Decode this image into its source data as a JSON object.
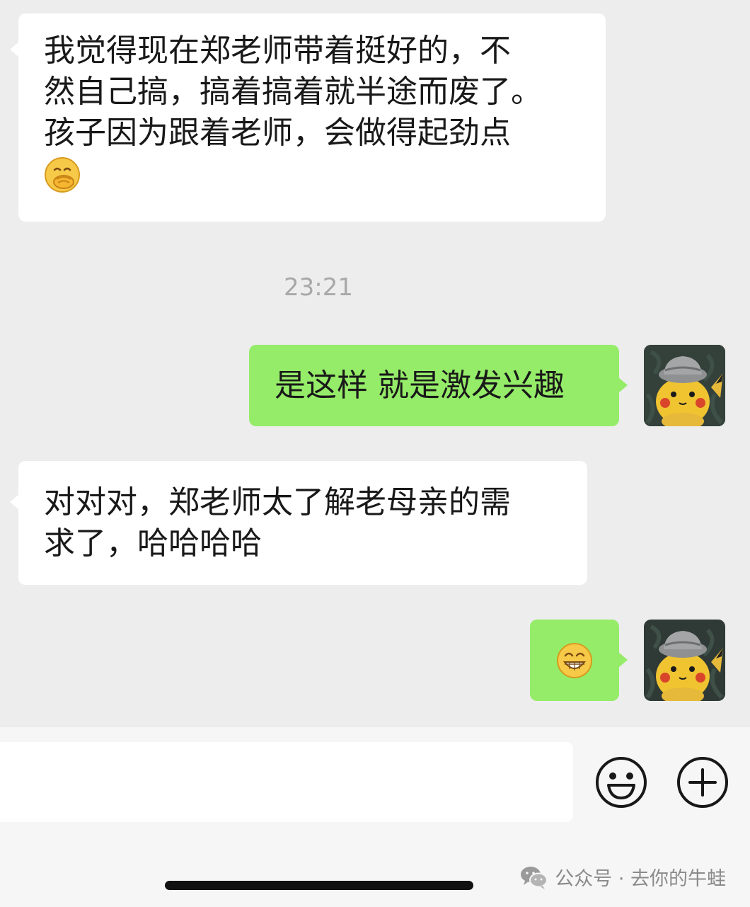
{
  "messages": [
    {
      "id": "m1",
      "direction": "incoming",
      "text": "我觉得现在郑老师带着挺好的，不\n然自己搞，搞着搞着就半途而废了。\n孩子因为跟着老师，会做得起劲点",
      "emoji": "hand-over-mouth-emoji"
    },
    {
      "id": "m2",
      "direction": "outgoing",
      "text": "是这样 就是激发兴趣"
    },
    {
      "id": "m3",
      "direction": "incoming",
      "text": "对对对，郑老师太了解老母亲的需\n求了，哈哈哈哈"
    },
    {
      "id": "m4",
      "direction": "outgoing",
      "emoji": "grinning-face-emoji"
    }
  ],
  "timestamp": "23:21",
  "input_bar": {
    "message_value": "",
    "emoji_icon": "smiley-face-icon",
    "plus_icon": "plus-circle-icon"
  },
  "watermark": {
    "text": "公众号 · 去你的牛蛙",
    "icon": "wechat-logo-icon"
  },
  "colors": {
    "background": "#ededed",
    "incoming_bubble": "#ffffff",
    "outgoing_bubble": "#95ec69",
    "timestamp": "#a8a8a8"
  }
}
